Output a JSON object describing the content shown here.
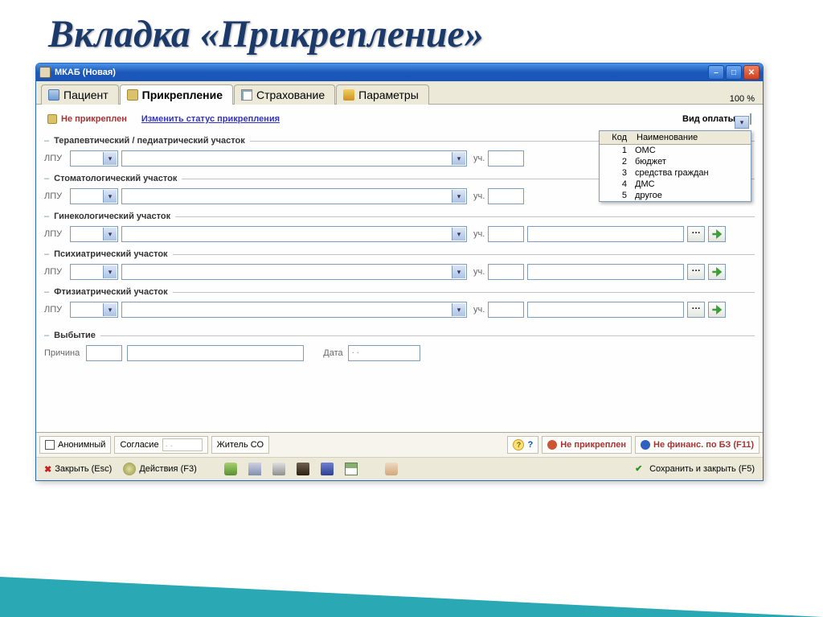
{
  "slide_title": "Вкладка «Прикрепление»",
  "window_title": "МКАБ (Новая)",
  "zoom": "100 %",
  "tabs": [
    {
      "label": "Пациент"
    },
    {
      "label": "Прикрепление"
    },
    {
      "label": "Страхование"
    },
    {
      "label": "Параметры"
    }
  ],
  "status": {
    "not_attached": "Не прикреплен",
    "change_link": "Изменить статус прикрепления",
    "pay_label": "Вид оплаты"
  },
  "dropdown": {
    "head_code": "Код",
    "head_name": "Наименование",
    "items": [
      {
        "code": "1",
        "name": "ОМС"
      },
      {
        "code": "2",
        "name": "бюджет"
      },
      {
        "code": "3",
        "name": "средства граждан"
      },
      {
        "code": "4",
        "name": "ДМС"
      },
      {
        "code": "5",
        "name": "другое"
      }
    ]
  },
  "sections": [
    {
      "title": "Терапевтический / педиатрический участок"
    },
    {
      "title": "Стоматологический участок"
    },
    {
      "title": "Гинекологический участок"
    },
    {
      "title": "Психиатрический участок"
    },
    {
      "title": "Фтизиатрический участок"
    }
  ],
  "labels": {
    "lpu": "ЛПУ",
    "uch": "уч.",
    "dots": "···"
  },
  "depart": {
    "title": "Выбытие",
    "reason": "Причина",
    "date": "Дата",
    "date_placeholder": ".  ."
  },
  "bottom": {
    "anon": "Анонимный",
    "consent": "Согласие",
    "consent_val": ".  .",
    "resident": "Житель СО",
    "question": "?",
    "not_attached": "Не прикреплен",
    "not_financed": "Не финанс. по БЗ (F11)"
  },
  "toolbar": {
    "close": "Закрыть (Esc)",
    "actions": "Действия (F3)",
    "save": "Сохранить и закрыть (F5)"
  }
}
